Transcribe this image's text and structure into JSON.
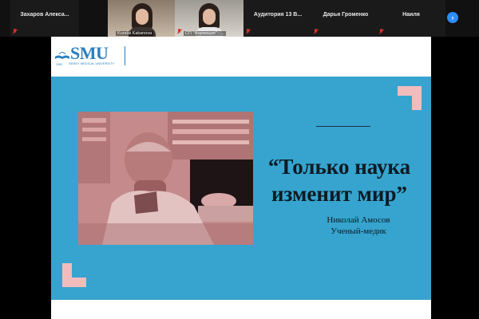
{
  "participants": [
    {
      "name": "Захаров  Алекса...",
      "muted": true,
      "video": false
    },
    {
      "name": "Kuralai Kakanova",
      "muted": false,
      "video": true
    },
    {
      "name": "СП \"Фармация\" - ...",
      "muted": true,
      "video": true
    },
    {
      "name": "Аудитория  13  В...",
      "muted": true,
      "video": false
    },
    {
      "name": "Дарья Громенко",
      "muted": true,
      "video": false
    },
    {
      "name": "Наиля",
      "muted": true,
      "video": false
    }
  ],
  "next_icon": "chevron-right-icon",
  "slide": {
    "logo_text": "SMU",
    "logo_subtitle": "SEMEY MEDICAL UNIVERSITY",
    "logo_year": "1953",
    "quote": "“Только наука изменит мир”",
    "author_name": "Николай Амосов",
    "author_role": "Ученый-медик"
  },
  "colors": {
    "panel": "#36a4cf",
    "accent": "#f2bcbd",
    "photo_tint": "#c88e8f",
    "logo_blue": "#2a7fbf",
    "zoom_blue": "#2d8cff"
  }
}
